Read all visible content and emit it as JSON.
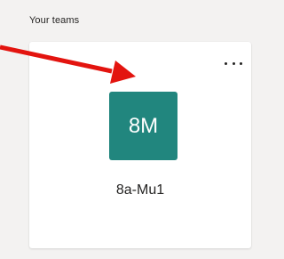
{
  "section": {
    "title": "Your teams"
  },
  "team_card": {
    "avatar_initials": "8M",
    "avatar_color": "#21867e",
    "name": "8a-Mu1",
    "more_options_icon": "ellipsis-icon"
  },
  "annotation": {
    "arrow_color": "#e3140f",
    "arrow_icon": "red-arrow-icon"
  }
}
